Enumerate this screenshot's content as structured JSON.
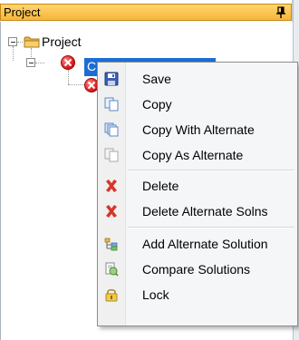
{
  "panel": {
    "title": "Project"
  },
  "tree": {
    "root_label": "Project",
    "selected_label": "C"
  },
  "menu": {
    "items": [
      {
        "label": "Save",
        "icon": "save-icon"
      },
      {
        "label": "Copy",
        "icon": "copy-icon"
      },
      {
        "label": "Copy With Alternate",
        "icon": "copy-with-alternate-icon"
      },
      {
        "label": "Copy As Alternate",
        "icon": "copy-as-alternate-icon"
      },
      {
        "label": "Delete",
        "icon": "delete-icon"
      },
      {
        "label": "Delete Alternate Solns",
        "icon": "delete-alternate-icon"
      },
      {
        "label": "Add Alternate Solution",
        "icon": "add-alternate-icon"
      },
      {
        "label": "Compare Solutions",
        "icon": "compare-icon"
      },
      {
        "label": "Lock",
        "icon": "lock-icon"
      }
    ]
  },
  "colors": {
    "title_bar": "#f7b53a",
    "selection": "#1b6ed3",
    "delete_red": "#d9342b"
  }
}
